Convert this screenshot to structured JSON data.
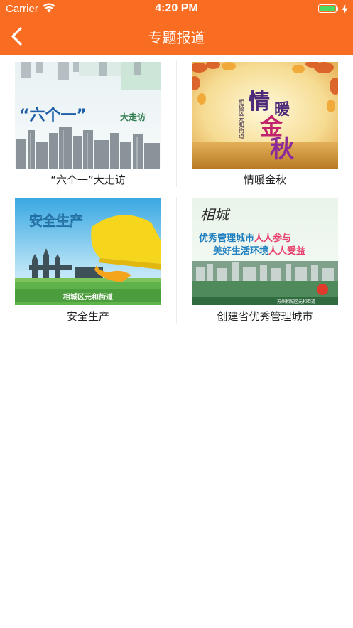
{
  "status_bar": {
    "carrier": "Carrier",
    "time": "4:20 PM",
    "battery_color": "#4cd964"
  },
  "nav": {
    "title": "专题报道",
    "back_icon": "chevron-left-icon",
    "bar_color": "#f96d22"
  },
  "topics": [
    {
      "caption": "“六个一”大走访",
      "thumb": {
        "headline": "“六个一”",
        "tag": "大走访"
      }
    },
    {
      "caption": "情暖金秋",
      "thumb": {
        "big_1": "情",
        "big_2": "暖",
        "big_3": "金",
        "big_4": "秋",
        "vertical": "相城区元和街道"
      }
    },
    {
      "caption": "安全生产",
      "thumb": {
        "headline": "安全生产",
        "footer": "相城区元和街道"
      }
    },
    {
      "caption": "创建省优秀管理城市",
      "thumb": {
        "logo": "相城",
        "line_1": "优秀管理城市",
        "line_1b": "人人参与",
        "line_2": "美好生活环境",
        "line_2b": "人人受益",
        "footer": "苏州相城区元和街道"
      }
    }
  ]
}
